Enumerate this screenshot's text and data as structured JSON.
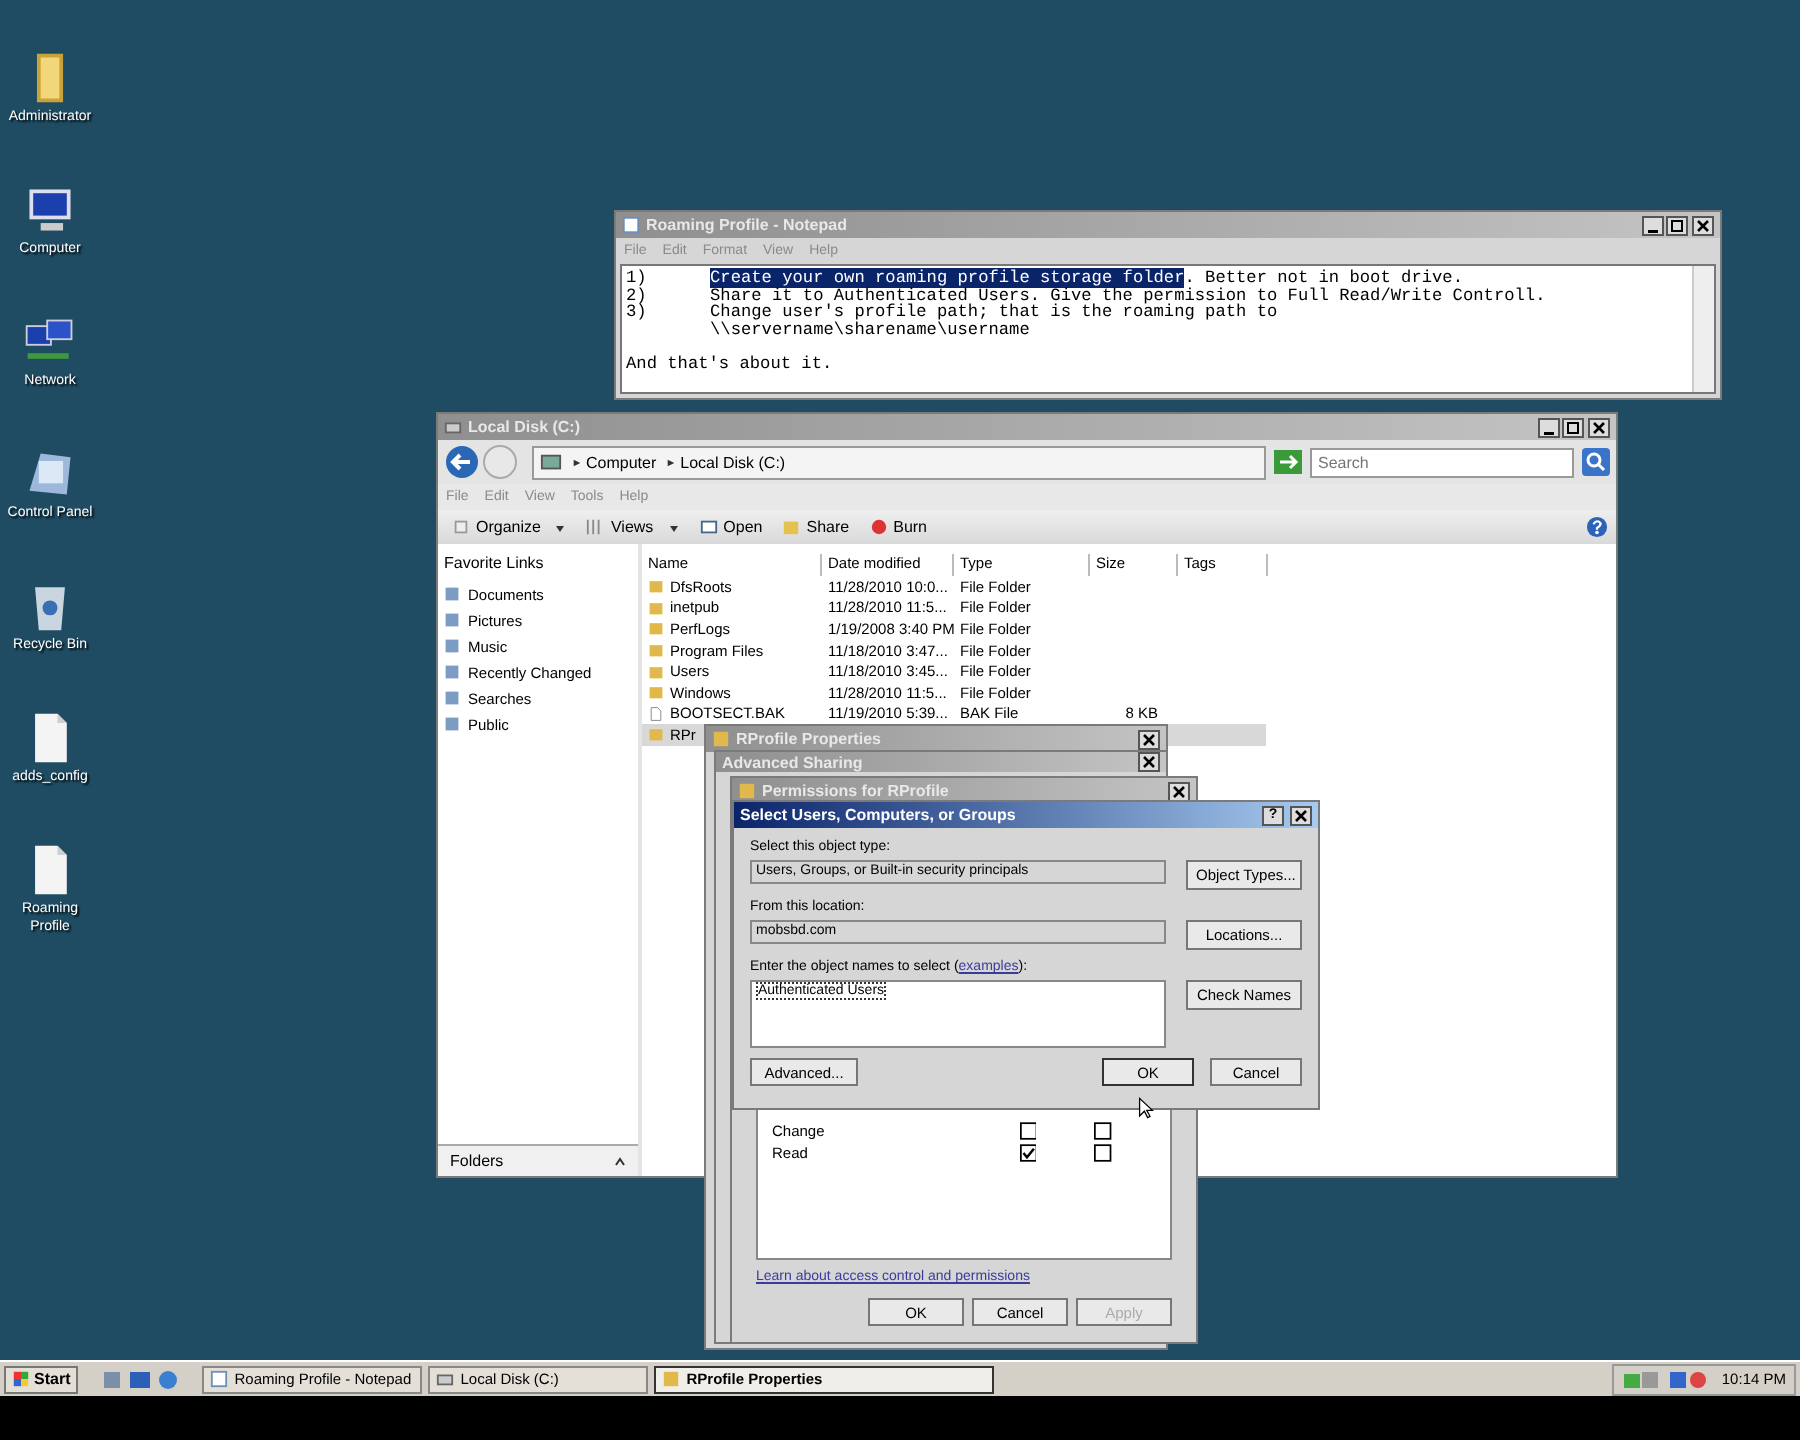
{
  "desktop_icons": [
    {
      "label": "Administrator",
      "kind": "folder"
    },
    {
      "label": "Computer",
      "kind": "computer"
    },
    {
      "label": "Network",
      "kind": "network"
    },
    {
      "label": "Control Panel",
      "kind": "control-panel"
    },
    {
      "label": "Recycle Bin",
      "kind": "recycle-bin"
    },
    {
      "label": "adds_config",
      "kind": "document"
    },
    {
      "label": "Roaming Profile",
      "kind": "document"
    }
  ],
  "notepad": {
    "title": "Roaming Profile - Notepad",
    "menu": [
      "File",
      "Edit",
      "Format",
      "View",
      "Help"
    ],
    "lines": [
      {
        "number": "1)",
        "parts": [
          {
            "text": "Create your own roaming profile storage folder",
            "selected": true
          },
          {
            "text": ". Better not in boot drive.",
            "selected": false
          }
        ]
      },
      {
        "number": "2)",
        "parts": [
          {
            "text": "Share it to Authenticated Users. Give the permission to Full Read/Write Controll.",
            "selected": false
          }
        ]
      },
      {
        "number": "3)",
        "parts": [
          {
            "text": "Change user's profile path; that is the roaming path to",
            "selected": false
          }
        ]
      },
      {
        "parts": [
          {
            "text": "\\\\servername\\sharename\\username",
            "selected": false
          }
        ]
      }
    ],
    "closing": "And that's about it."
  },
  "explorer": {
    "title": "Local Disk (C:)",
    "breadcrumb": [
      "Computer",
      "Local Disk (C:)"
    ],
    "search": {
      "placeholder": "Search"
    },
    "menu": [
      "File",
      "Edit",
      "View",
      "Tools",
      "Help"
    ],
    "toolbar": [
      {
        "label": "Organize",
        "kind": "organize"
      },
      {
        "label": "Views",
        "kind": "views"
      },
      {
        "label": "Open",
        "kind": "open"
      },
      {
        "label": "Share",
        "kind": "share"
      },
      {
        "label": "Burn",
        "kind": "burn"
      }
    ],
    "favorite_links": {
      "title": "Favorite Links",
      "items": [
        {
          "label": "Documents"
        },
        {
          "label": "Pictures"
        },
        {
          "label": "Music"
        },
        {
          "label": "Recently Changed"
        },
        {
          "label": "Searches"
        },
        {
          "label": "Public"
        }
      ]
    },
    "columns": [
      "Name",
      "Date modified",
      "Type",
      "Size",
      "Tags"
    ],
    "rows": [
      {
        "name": "DfsRoots",
        "date": "11/28/2010 10:0...",
        "type": "File Folder",
        "kind": "folder",
        "selected": false
      },
      {
        "name": "inetpub",
        "date": "11/28/2010 11:5...",
        "type": "File Folder",
        "kind": "folder",
        "selected": false
      },
      {
        "name": "PerfLogs",
        "date": "1/19/2008 3:40 PM",
        "type": "File Folder",
        "kind": "folder",
        "selected": false
      },
      {
        "name": "Program Files",
        "date": "11/18/2010 3:47...",
        "type": "File Folder",
        "kind": "folder",
        "selected": false
      },
      {
        "name": "Users",
        "date": "11/18/2010 3:45...",
        "type": "File Folder",
        "kind": "folder",
        "selected": false
      },
      {
        "name": "Windows",
        "date": "11/28/2010 11:5...",
        "type": "File Folder",
        "kind": "folder",
        "selected": false
      },
      {
        "name": "BOOTSECT.BAK",
        "date": "11/19/2010 5:39...",
        "type": "BAK File",
        "size": "8 KB",
        "kind": "file",
        "selected": false
      },
      {
        "name": "RPr",
        "kind": "folder",
        "selected": true
      }
    ],
    "folders_pane": "Folders"
  },
  "properties_window": {
    "title": "RProfile Properties"
  },
  "advanced_sharing": {
    "title": "Advanced Sharing"
  },
  "permissions": {
    "title": "Permissions for RProfile",
    "entries": [
      {
        "name": "Change",
        "allow": false,
        "deny": false
      },
      {
        "name": "Read",
        "allow": true,
        "deny": false
      }
    ],
    "help_link": "Learn about access control and permissions",
    "buttons": [
      {
        "label": "OK",
        "disabled": false
      },
      {
        "label": "Cancel",
        "disabled": false
      },
      {
        "label": "Apply",
        "disabled": true
      }
    ]
  },
  "select_dialog": {
    "title": "Select Users, Computers, or Groups",
    "help_button": "?",
    "object_type_label": "Select this object type:",
    "object_type": "Users, Groups, or Built-in security principals",
    "object_types_button": "Object Types...",
    "location_label": "From this location:",
    "location": "mobsbd.com",
    "locations_button": "Locations...",
    "names_label_before": "Enter the object names to select (",
    "names_link": "examples",
    "names_label_after": "):",
    "names_value": "Authenticated Users",
    "check_names_button": "Check Names",
    "advanced_button": "Advanced...",
    "ok_button": "OK",
    "cancel_button": "Cancel"
  },
  "taskbar": {
    "start": "Start",
    "tasks": [
      {
        "label": "Roaming Profile - Notepad",
        "kind": "notepad",
        "selected": false
      },
      {
        "label": "Local Disk (C:)",
        "kind": "disk",
        "selected": false
      },
      {
        "label": "RProfile Properties",
        "kind": "folder",
        "selected": true
      }
    ],
    "clock": "10:14 PM"
  }
}
